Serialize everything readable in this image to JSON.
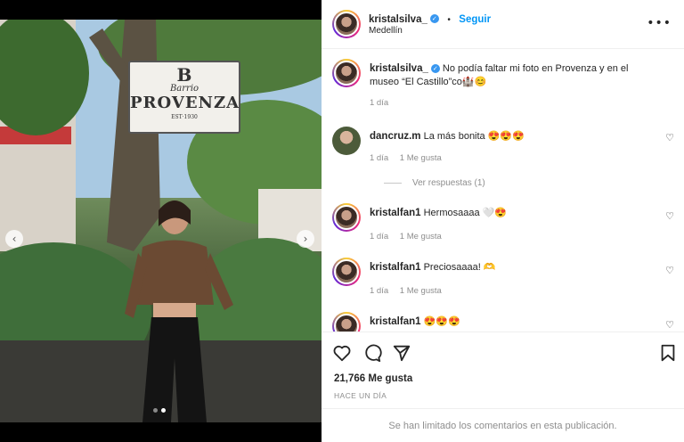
{
  "post": {
    "author": "kristalsilva_",
    "follow_label": "Seguir",
    "location": "Medellín",
    "more_icon": "more-horizontal-icon",
    "sign": {
      "logo": "B",
      "line1": "Barrio",
      "line2": "PROVENZA",
      "line3": "EST·1930"
    },
    "carousel": {
      "prev_icon": "‹",
      "next_icon": "›",
      "slides": 2,
      "active": 2
    }
  },
  "caption": {
    "author": "kristalsilva_",
    "text": "No podía faltar mi foto en Provenza y en el museo “El Castillo”co🏰😊",
    "time": "1 día"
  },
  "comments": [
    {
      "author": "dancruz.m",
      "text": "La más bonita 😍😍😍",
      "time": "1 día",
      "likes": "1 Me gusta",
      "replies": "Ver respuestas (1)"
    },
    {
      "author": "kristalfan1",
      "text": "Hermosaaaa 🤍😍",
      "time": "1 día",
      "likes": "1 Me gusta"
    },
    {
      "author": "kristalfan1",
      "text": "Preciosaaaa! 🫶",
      "time": "1 día",
      "likes": "1 Me gusta"
    },
    {
      "author": "kristalfan1",
      "text": "😍😍😍"
    }
  ],
  "actions": {
    "likes": "21,766 Me gusta",
    "date": "HACE UN DÍA"
  },
  "footer": {
    "notice": "Se han limitado los comentarios en esta publicación."
  },
  "colors": {
    "accent": "#0095f6",
    "verified": "#3897f0",
    "muted": "#8e8e8e"
  }
}
